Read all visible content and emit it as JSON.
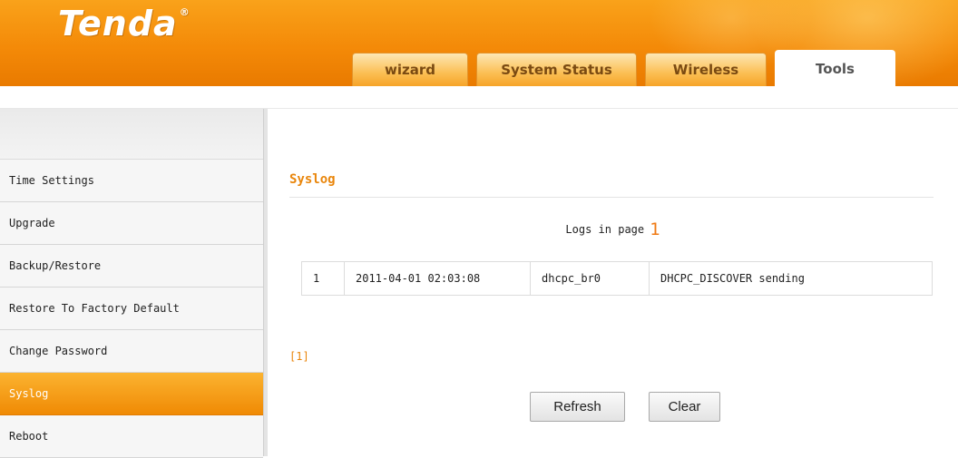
{
  "brand": {
    "logo_text": "Tenda",
    "registered_mark": "®"
  },
  "colors": {
    "accent": "#f08a04",
    "header_orange": "#f48a08",
    "section_title": "#e9860c"
  },
  "tabs": [
    {
      "label": "wizard",
      "active": false
    },
    {
      "label": "System Status",
      "active": false
    },
    {
      "label": "Wireless",
      "active": false
    },
    {
      "label": "Tools",
      "active": true
    }
  ],
  "sidebar": {
    "items": [
      {
        "label": "Time Settings",
        "active": false
      },
      {
        "label": "Upgrade",
        "active": false
      },
      {
        "label": "Backup/Restore",
        "active": false
      },
      {
        "label": "Restore To Factory Default",
        "active": false
      },
      {
        "label": "Change Password",
        "active": false
      },
      {
        "label": "Syslog",
        "active": true
      },
      {
        "label": "Reboot",
        "active": false
      }
    ]
  },
  "main": {
    "section_title": "Syslog",
    "logs_label": "Logs in page",
    "current_page": "1",
    "logs": [
      {
        "index": "1",
        "time": "2011-04-01 02:03:08",
        "source": "dhcpc_br0",
        "message": "DHCPC_DISCOVER sending"
      }
    ],
    "pager": "[1]",
    "buttons": {
      "refresh": "Refresh",
      "clear": "Clear"
    }
  }
}
